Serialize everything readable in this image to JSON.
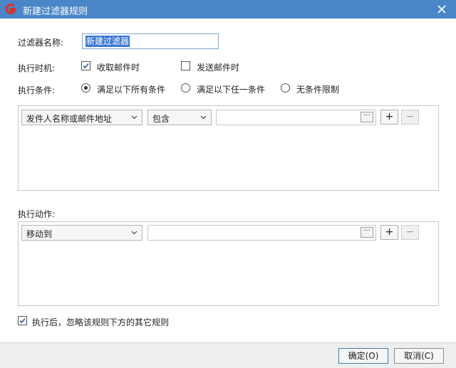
{
  "window": {
    "title": "新建过滤器规则"
  },
  "form": {
    "name_label": "过滤器名称:",
    "name_value": "新建过滤器",
    "timing_label": "执行时机:",
    "timing_receive": {
      "label": "收取邮件时",
      "checked": true
    },
    "timing_send": {
      "label": "发送邮件时",
      "checked": false
    },
    "condition_label": "执行条件:",
    "condition_options": [
      {
        "label": "满足以下所有条件",
        "selected": true
      },
      {
        "label": "满足以下任一条件",
        "selected": false
      },
      {
        "label": "无条件限制",
        "selected": false
      }
    ]
  },
  "conditions": {
    "field_select": "发件人名称或邮件地址",
    "operator_select": "包含",
    "value": "",
    "browse_label": "···",
    "add_label": "+",
    "remove_label": "−"
  },
  "actions": {
    "section_label": "执行动作:",
    "action_select": "移动到",
    "target_value": "",
    "browse_label": "···",
    "add_label": "+",
    "remove_label": "−"
  },
  "ignore_rules": {
    "label": "执行后，忽略该规则下方的其它规则",
    "checked": true
  },
  "footer": {
    "ok_label": "确定(O)",
    "cancel_label": "取消(C)"
  },
  "colors": {
    "titlebar": "#4a86c8",
    "selection": "#3a78d4",
    "logo": "#d8322a"
  }
}
